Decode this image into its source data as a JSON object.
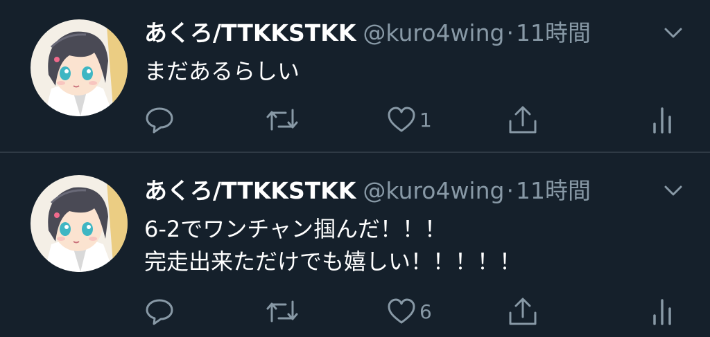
{
  "theme": {
    "background": "#15202b",
    "text": "#ffffff",
    "muted": "#8899a6",
    "divider": "#2f3a45"
  },
  "tweets": [
    {
      "display_name": "あくろ/TTKKSTKK",
      "handle": "@kuro4wing",
      "separator": "·",
      "time": "11時間",
      "lines": [
        "まだあるらしい"
      ],
      "like_count": "1",
      "icons": [
        "reply-icon",
        "retweet-icon",
        "like-icon",
        "share-icon",
        "analytics-icon"
      ]
    },
    {
      "display_name": "あくろ/TTKKSTKK",
      "handle": "@kuro4wing",
      "separator": "·",
      "time": "11時間",
      "lines": [
        "6-2でワンチャン掴んだ！！！",
        "完走出来ただけでも嬉しい！！！！！"
      ],
      "like_count": "6",
      "icons": [
        "reply-icon",
        "retweet-icon",
        "like-icon",
        "share-icon",
        "analytics-icon"
      ]
    }
  ]
}
